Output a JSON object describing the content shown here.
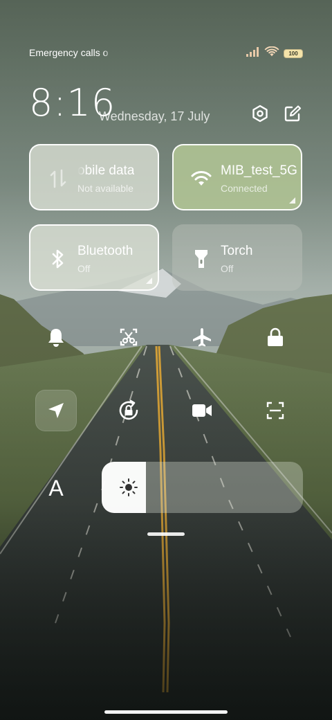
{
  "status_bar": {
    "carrier_text": "Emergency calls o",
    "battery_level": "100",
    "icons": [
      "signal-bars-icon",
      "wifi-icon",
      "battery-icon"
    ]
  },
  "header": {
    "time": "8:16",
    "date": "Wednesday, 17 July",
    "settings_icon": "settings-hexagon-icon",
    "edit_icon": "edit-icon"
  },
  "tiles": [
    {
      "id": "mobile-data",
      "title": "obile data",
      "subtitle": "Not available",
      "state": "on",
      "icon": "mobile-data-arrows-icon"
    },
    {
      "id": "wifi",
      "title": "MIB_test_5G",
      "subtitle": "Connected",
      "state": "active",
      "icon": "wifi-icon"
    },
    {
      "id": "bluetooth",
      "title": "Bluetooth",
      "subtitle": "Off",
      "state": "on",
      "icon": "bluetooth-icon"
    },
    {
      "id": "torch",
      "title": "Torch",
      "subtitle": "Off",
      "state": "off",
      "icon": "flashlight-icon"
    }
  ],
  "toggles_row1": [
    "bell-icon",
    "screenshot-scissors-icon",
    "airplane-icon",
    "lock-icon"
  ],
  "toggles_row2": [
    "location-arrow-icon",
    "rotation-lock-icon",
    "video-camera-icon",
    "scan-icon"
  ],
  "brightness": {
    "level": 0.22,
    "icon": "sun-icon",
    "font_button_label": "A"
  },
  "colors": {
    "wifi_tile": "#b0c494",
    "tile_border": "#ffffff"
  }
}
